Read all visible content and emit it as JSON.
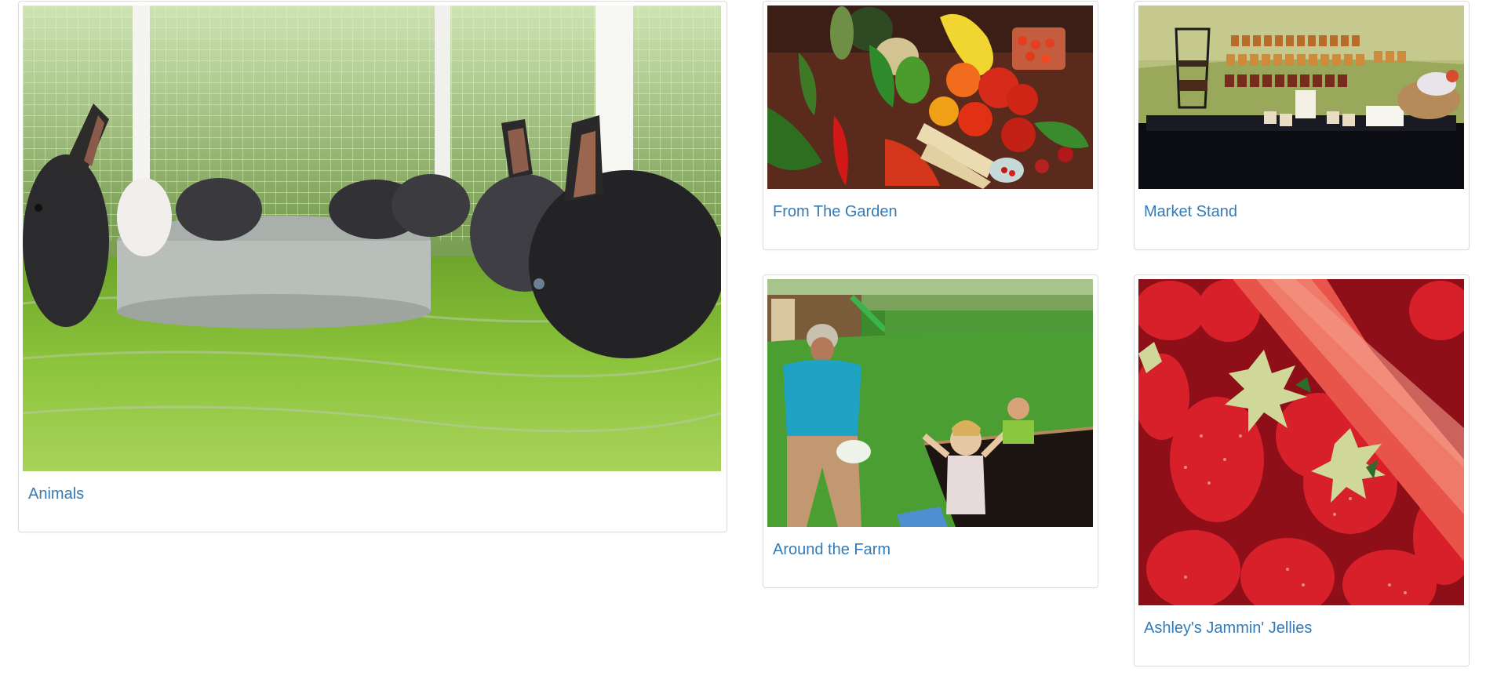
{
  "gallery": {
    "items": [
      {
        "label": "Animals",
        "image": "rabbits-in-grass-photo"
      },
      {
        "label": "From The Garden",
        "image": "harvested-vegetables-photo"
      },
      {
        "label": "Market Stand",
        "image": "jars-on-market-table-photo"
      },
      {
        "label": "Around the Farm",
        "image": "family-in-garden-photo"
      },
      {
        "label": "Ashley's Jammin' Jellies",
        "image": "strawberries-and-rhubarb-photo"
      }
    ]
  },
  "colors": {
    "link": "#337ab7",
    "card_border": "#dddddd",
    "background": "#ffffff"
  }
}
